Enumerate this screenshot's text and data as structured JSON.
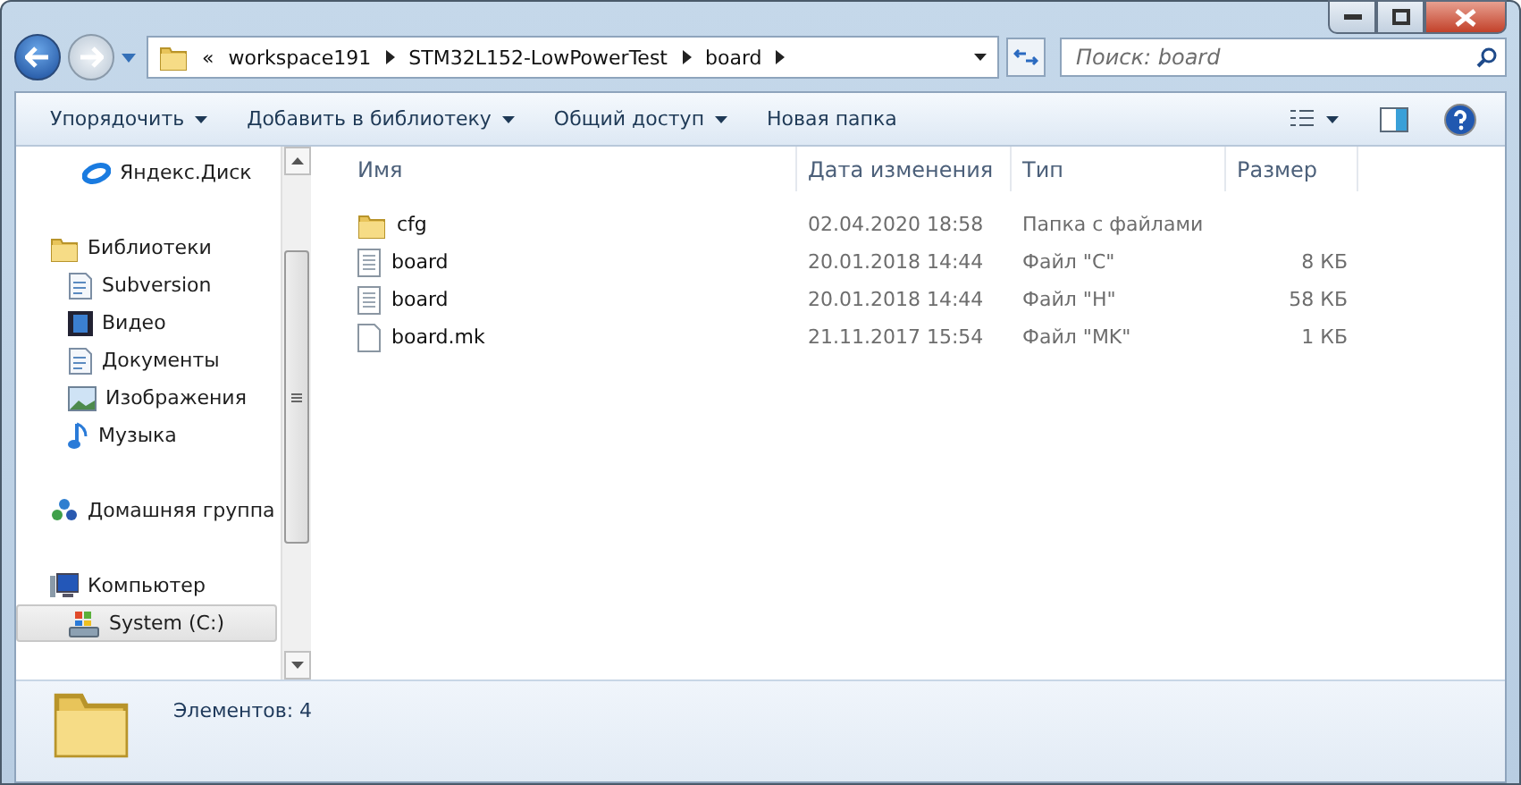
{
  "address": {
    "overflow": "«",
    "crumbs": [
      "workspace191",
      "STM32L152-LowPowerTest",
      "board"
    ]
  },
  "search": {
    "placeholder": "Поиск: board"
  },
  "toolbar": [
    {
      "label": "Упорядочить",
      "dropdown": true
    },
    {
      "label": "Добавить в библиотеку",
      "dropdown": true
    },
    {
      "label": "Общий доступ",
      "dropdown": true
    },
    {
      "label": "Новая папка",
      "dropdown": false
    }
  ],
  "nav": [
    {
      "label": "Яндекс.Диск",
      "kind": "cloud",
      "selected": false
    },
    {
      "label": "Библиотеки",
      "kind": "library",
      "selected": false,
      "children": [
        {
          "label": "Subversion",
          "kind": "document",
          "selected": false
        },
        {
          "label": "Видео",
          "kind": "video",
          "selected": false
        },
        {
          "label": "Документы",
          "kind": "document",
          "selected": false
        },
        {
          "label": "Изображения",
          "kind": "image",
          "selected": false
        },
        {
          "label": "Музыка",
          "kind": "music",
          "selected": false
        }
      ]
    },
    {
      "label": "Домашняя группа",
      "kind": "homegroup",
      "selected": false
    },
    {
      "label": "Компьютер",
      "kind": "computer",
      "selected": false,
      "children": [
        {
          "label": "System (C:)",
          "kind": "drive",
          "selected": true
        }
      ]
    }
  ],
  "columns": [
    "Имя",
    "Дата изменения",
    "Тип",
    "Размер"
  ],
  "rows": [
    {
      "name": "cfg",
      "kind": "folder",
      "date": "02.04.2020 18:58",
      "type": "Папка с файлами"
    },
    {
      "name": "board",
      "kind": "text",
      "date": "20.01.2018 14:44",
      "type": "Файл \"C\"",
      "size": "8 КБ"
    },
    {
      "name": "board",
      "kind": "text",
      "date": "20.01.2018 14:44",
      "type": "Файл \"H\"",
      "size": "58 КБ"
    },
    {
      "name": "board.mk",
      "kind": "blank",
      "date": "21.11.2017 15:54",
      "type": "Файл \"MK\"",
      "size": "1 КБ"
    }
  ],
  "status": {
    "text": "Элементов: 4"
  }
}
